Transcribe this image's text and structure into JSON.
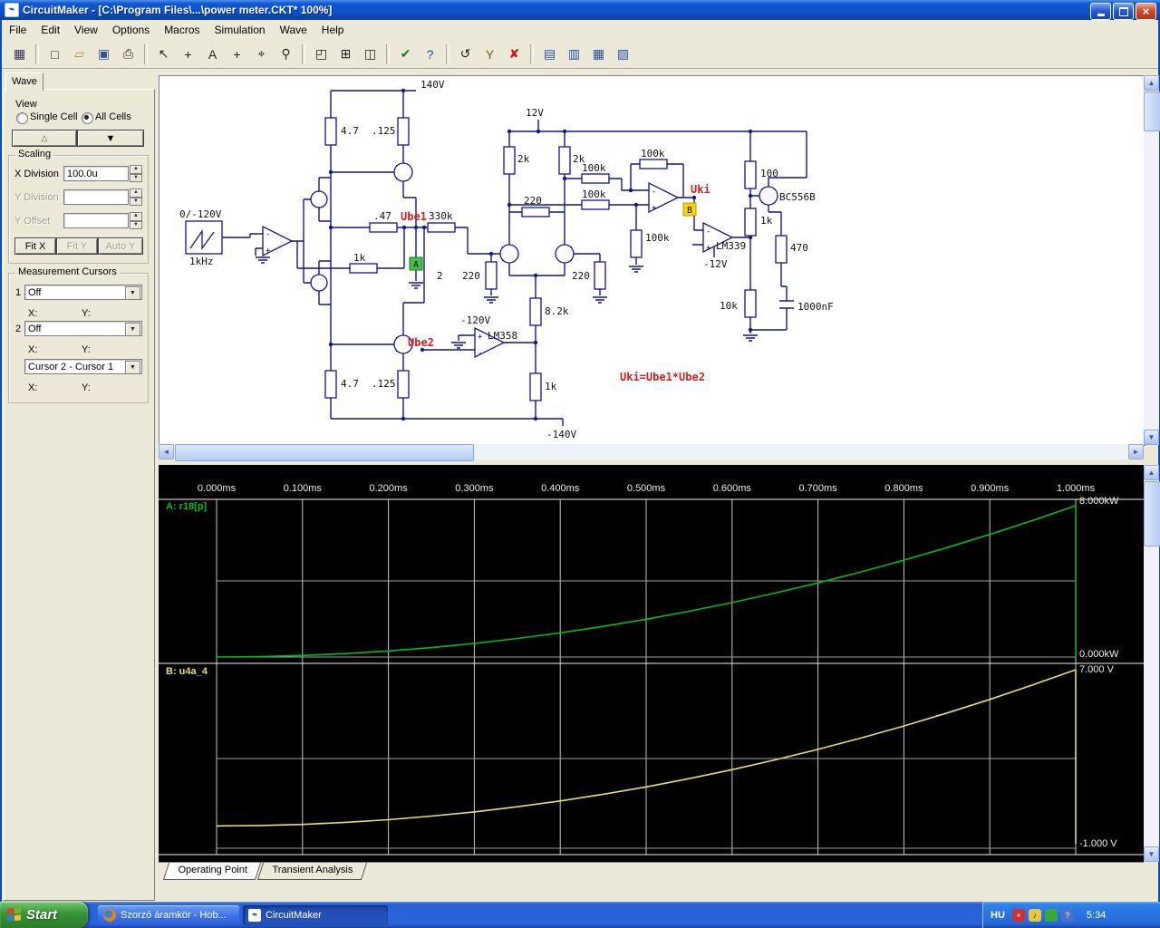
{
  "window": {
    "title": "CircuitMaker - [C:\\Program Files\\...\\power meter.CKT* 100%]"
  },
  "icons": {
    "up": "▲",
    "down": "▼",
    "left": "◄",
    "right": "►",
    "close": "×",
    "dropdown": "▼"
  },
  "menu": {
    "items": [
      "File",
      "Edit",
      "View",
      "Options",
      "Macros",
      "Simulation",
      "Wave",
      "Help"
    ]
  },
  "toolbar": {
    "groups": [
      [
        {
          "name": "part-browser",
          "glyph": "▦",
          "color": "#333355"
        }
      ],
      [
        {
          "name": "new-file",
          "glyph": "□"
        },
        {
          "name": "open-file",
          "glyph": "▱",
          "color": "#b08a28"
        },
        {
          "name": "save-file",
          "glyph": "▣",
          "color": "#33519e"
        },
        {
          "name": "print",
          "glyph": "⎙"
        }
      ],
      [
        {
          "name": "select-tool",
          "glyph": "↖"
        },
        {
          "name": "wire-tool",
          "glyph": "+"
        },
        {
          "name": "text-tool",
          "glyph": "A"
        },
        {
          "name": "plus-tool",
          "glyph": "+"
        },
        {
          "name": "probe-tool",
          "glyph": "⌖"
        },
        {
          "name": "zoom-tool",
          "glyph": "⚲"
        }
      ],
      [
        {
          "name": "zoom-window",
          "glyph": "◰"
        },
        {
          "name": "copy-tool",
          "glyph": "⊞"
        },
        {
          "name": "split-view",
          "glyph": "◫"
        }
      ],
      [
        {
          "name": "check-simulation",
          "glyph": "✔",
          "color": "#1a7a1a"
        },
        {
          "name": "help",
          "glyph": "?",
          "color": "#1a3ab8"
        }
      ],
      [
        {
          "name": "undo",
          "glyph": "↺"
        },
        {
          "name": "probe-y",
          "glyph": "Y",
          "color": "#7a5a10"
        },
        {
          "name": "stop-simulation",
          "glyph": "✘",
          "color": "#cc1111"
        }
      ],
      [
        {
          "name": "scope-window-1",
          "glyph": "▤",
          "color": "#2a4fae"
        },
        {
          "name": "scope-window-2",
          "glyph": "▥",
          "color": "#2a4fae"
        },
        {
          "name": "scope-window-3",
          "glyph": "▦",
          "color": "#2a4fae"
        },
        {
          "name": "scope-window-4",
          "glyph": "▧",
          "color": "#2a4fae"
        }
      ]
    ]
  },
  "wave_panel": {
    "tab": "Wave",
    "view_label": "View",
    "single_cell": "Single Cell",
    "all_cells": "All Cells",
    "up_glyph": "△",
    "down_glyph": "▼",
    "scaling": {
      "title": "Scaling",
      "x_label": "X Division",
      "x_value": "100.0u",
      "y_label": "Y Division",
      "y_value": "",
      "offset_label": "Y Offset",
      "offset_value": "",
      "fit_x": "Fit X",
      "fit_y": "Fit Y",
      "auto_y": "Auto Y"
    },
    "cursors": {
      "title": "Measurement Cursors",
      "c1": "1",
      "c1_value": "Off",
      "c2": "2",
      "c2_value": "Off",
      "diff_value": "Cursor 2 - Cursor 1",
      "x": "X:",
      "y": "Y:"
    }
  },
  "circuit": {
    "labels": {
      "v140": "140V",
      "r47a": "4.7",
      "r125a": ".125",
      "v12": "12V",
      "r2k1": "2k",
      "r2k2": "2k",
      "r100k1": "100k",
      "r100k2": "100k",
      "r100k3": "100k",
      "src": "0/-120V",
      "freq": "1kHz",
      "r47": ".47",
      "ube1": "Ube1",
      "r330k": "330k",
      "r220a": "220",
      "uki": "Uki",
      "r100k4": "100k",
      "r100": "100",
      "q7": "BC556B",
      "r1k2": "1k",
      "r470": "470",
      "u339": "LM339",
      "vn12": "-12V",
      "r1k1": "1k",
      "node2": "2",
      "r220b": "220",
      "r220c": "220",
      "r82k": "8.2k",
      "vn120": "-120V",
      "u358": "LM358",
      "ube2": "Ube2",
      "r10k": "10k",
      "c1": "1000nF",
      "r47b": "4.7",
      "r125b": ".125",
      "r1k3": "1k",
      "formula": "Uki=Ube1*Ube2",
      "vn140": "-140V",
      "probe_a": "A",
      "probe_b": "B"
    }
  },
  "chart_data": {
    "type": "line",
    "x_unit": "ms",
    "x_ticks": [
      "0.000ms",
      "0.100ms",
      "0.200ms",
      "0.300ms",
      "0.400ms",
      "0.500ms",
      "0.600ms",
      "0.700ms",
      "0.800ms",
      "0.900ms",
      "1.000ms"
    ],
    "panels": [
      {
        "name": "A: r18[p]",
        "color": "#00bb22",
        "y_top_label": "8.000kW",
        "y_bottom_label": "0.000kW",
        "y_range": [
          0,
          8
        ],
        "drop_to": 0,
        "x": [
          0,
          0.05,
          0.1,
          0.15,
          0.2,
          0.25,
          0.3,
          0.35,
          0.4,
          0.45,
          0.5,
          0.55,
          0.6,
          0.65,
          0.7,
          0.75,
          0.8,
          0.85,
          0.9,
          0.95,
          1
        ],
        "values": [
          0,
          0.02,
          0.08,
          0.18,
          0.32,
          0.5,
          0.72,
          0.98,
          1.28,
          1.62,
          2,
          2.42,
          2.88,
          3.38,
          3.92,
          4.5,
          5.12,
          5.78,
          6.48,
          7.22,
          8
        ]
      },
      {
        "name": "B: u4a_4",
        "color": "#e6de7a",
        "y_top_label": "7.000 V",
        "y_bottom_label": "-1.000 V",
        "y_range": [
          -1,
          7
        ],
        "drop_to": -0.8,
        "x": [
          0,
          0.05,
          0.1,
          0.15,
          0.2,
          0.25,
          0.3,
          0.35,
          0.4,
          0.45,
          0.5,
          0.55,
          0.6,
          0.65,
          0.7,
          0.75,
          0.8,
          0.85,
          0.9,
          0.95,
          1
        ],
        "values": [
          0,
          0.02,
          0.07,
          0.16,
          0.28,
          0.44,
          0.63,
          0.86,
          1.12,
          1.42,
          1.75,
          2.12,
          2.52,
          2.96,
          3.43,
          3.94,
          4.48,
          5.06,
          5.67,
          6.32,
          7
        ]
      }
    ]
  },
  "bottom_tabs": {
    "t1": "Operating Point",
    "t2": "Transient Analysis"
  },
  "taskbar": {
    "start": "Start",
    "task1": "Szorzó áramkör - Hob...",
    "task2": "CircuitMaker",
    "lang": "HU",
    "time": "5:34"
  }
}
